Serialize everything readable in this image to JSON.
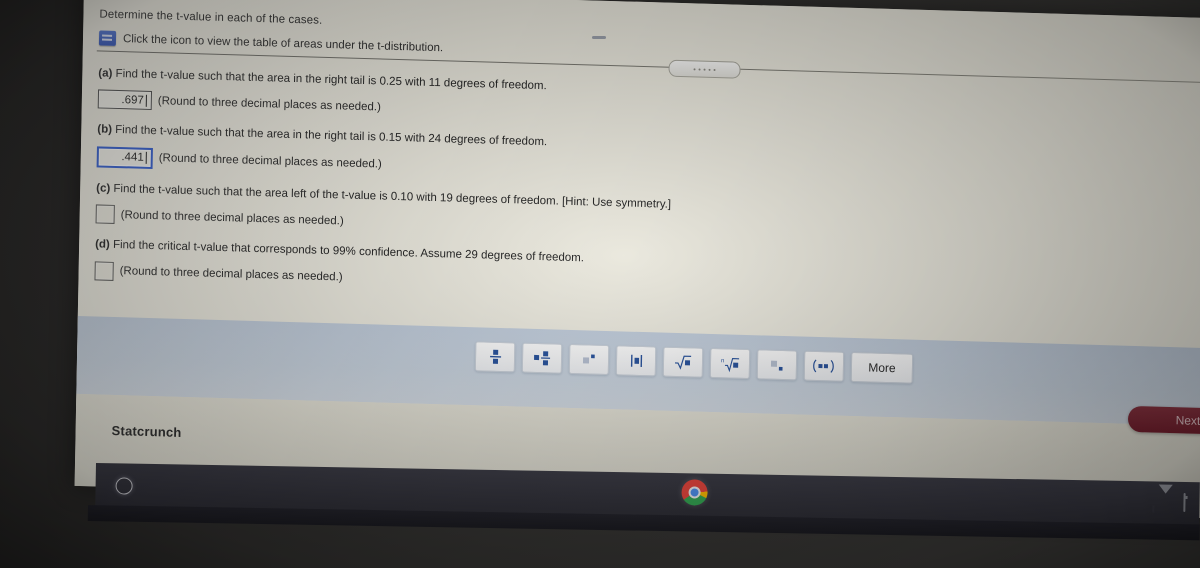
{
  "header": {
    "instruction": "Determine the t-value in each of the cases.",
    "icon_link_text": "Click the icon to view the table of areas under the t-distribution.",
    "icon_name": "table-document-icon"
  },
  "parts": [
    {
      "id": "a",
      "label": "(a)",
      "question": "Find the t-value such that the area in the right tail is 0.25 with 11 degrees of freedom.",
      "answer_value": ".697",
      "answer_state": "filled",
      "rounding_note": "(Round to three decimal places as needed.)"
    },
    {
      "id": "b",
      "label": "(b)",
      "question": "Find the t-value such that the area in the right tail is 0.15 with 24 degrees of freedom.",
      "answer_value": ".441",
      "answer_state": "focused",
      "rounding_note": "(Round to three decimal places as needed.)"
    },
    {
      "id": "c",
      "label": "(c)",
      "question": "Find the t-value such that the area left of the t-value is 0.10 with 19 degrees of freedom. [Hint: Use symmetry.]",
      "answer_value": "",
      "answer_state": "empty",
      "rounding_note": "(Round to three decimal places as needed.)"
    },
    {
      "id": "d",
      "label": "(d)",
      "question": "Find the critical t-value that corresponds to 99% confidence. Assume 29 degrees of freedom.",
      "answer_value": "",
      "answer_state": "empty",
      "rounding_note": "(Round to three decimal places as needed.)"
    }
  ],
  "math_toolbar": {
    "buttons": [
      {
        "name": "fraction-button",
        "glyph": "▪̸▪",
        "label": "fraction"
      },
      {
        "name": "mixed-number-button",
        "glyph": "▪▪̸▪",
        "label": "mixed number"
      },
      {
        "name": "exponent-button",
        "glyph": "▪▪",
        "label": "exponent"
      },
      {
        "name": "absolute-value-button",
        "glyph": "|▪|",
        "label": "absolute value"
      },
      {
        "name": "square-root-button",
        "glyph": "√▪",
        "label": "square root"
      },
      {
        "name": "nth-root-button",
        "glyph": "ⁿ√▪",
        "label": "nth root"
      },
      {
        "name": "subscript-button",
        "glyph": "▪▪",
        "label": "subscript"
      },
      {
        "name": "interval-notation-button",
        "glyph": "(▪,▪)",
        "label": "interval notation"
      }
    ],
    "more_label": "More"
  },
  "footer": {
    "statcrunch_label": "Statcrunch",
    "next_label": "Next"
  },
  "taskbar": {
    "start_icon": "start-circle-icon",
    "chrome_icon": "chrome-icon",
    "tray_icons": [
      "info-circle-icon",
      "wifi-icon",
      "battery-icon"
    ]
  },
  "colors": {
    "page_background": "#eeece1",
    "toolbar_band": "#cbd6e2",
    "next_button": "#78202f",
    "accent_blue": "#27529e",
    "surround": "#2e2d2c"
  }
}
